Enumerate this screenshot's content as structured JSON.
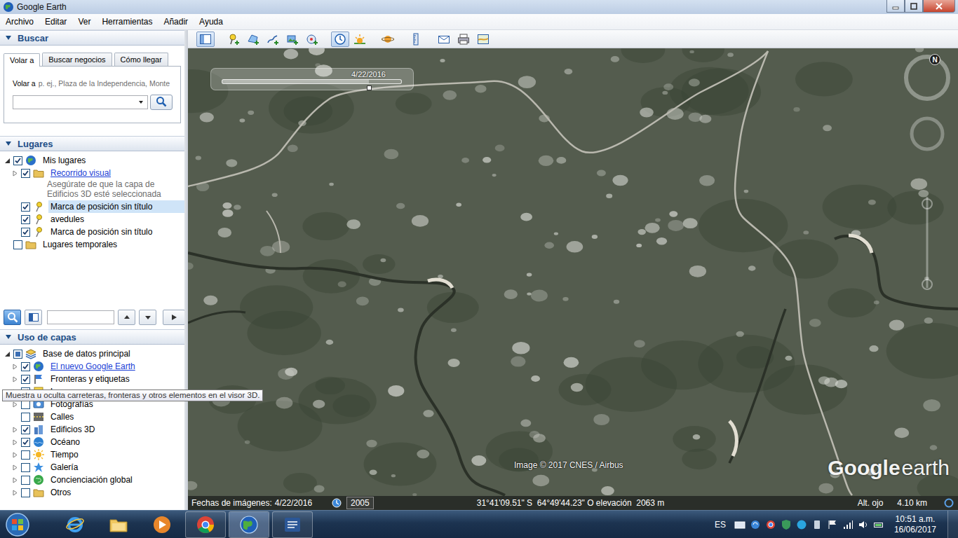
{
  "window": {
    "title": "Google Earth"
  },
  "menu": [
    "Archivo",
    "Editar",
    "Ver",
    "Herramientas",
    "Añadir",
    "Ayuda"
  ],
  "search": {
    "header": "Buscar",
    "expanded": true,
    "tabs": [
      {
        "label": "Volar a",
        "selected": true
      },
      {
        "label": "Buscar negocios",
        "selected": false
      },
      {
        "label": "Cómo llegar",
        "selected": false
      }
    ],
    "prompt": "Volar a",
    "hint": "p. ej., Plaza de la Independencia, Monte"
  },
  "places": {
    "header": "Lugares",
    "expanded": true,
    "items": [
      {
        "label": "Mis lugares",
        "depth": 0,
        "kind": "globe",
        "has_children": true,
        "expanded": true,
        "checked": true,
        "partial": false,
        "selected": false,
        "link": false
      },
      {
        "label": "Recorrido visual",
        "depth": 1,
        "kind": "folder",
        "has_children": true,
        "expanded": false,
        "checked": true,
        "partial": false,
        "selected": false,
        "link": true,
        "note": "Asegúrate de que la capa de Edificios 3D esté seleccionada"
      },
      {
        "label": "Marca de posición sin título",
        "depth": 1,
        "kind": "placemark",
        "has_children": false,
        "expanded": false,
        "checked": true,
        "partial": false,
        "selected": true,
        "link": false
      },
      {
        "label": "avedules",
        "depth": 1,
        "kind": "placemark",
        "has_children": false,
        "expanded": false,
        "checked": true,
        "partial": false,
        "selected": false,
        "link": false
      },
      {
        "label": "Marca de posición sin título",
        "depth": 1,
        "kind": "placemark",
        "has_children": false,
        "expanded": false,
        "checked": true,
        "partial": false,
        "selected": false,
        "link": false
      },
      {
        "label": "Lugares temporales",
        "depth": 0,
        "kind": "folder",
        "has_children": false,
        "expanded": false,
        "checked": false,
        "partial": false,
        "selected": false,
        "link": false
      }
    ]
  },
  "panel_tools": [
    {
      "kind": "search",
      "selected": true
    },
    {
      "kind": "panel",
      "selected": false
    }
  ],
  "layers": {
    "header": "Uso de capas",
    "expanded": true,
    "items": [
      {
        "label": "Base de datos principal",
        "depth": 0,
        "kind": "database",
        "has_children": true,
        "expanded": true,
        "checked": true,
        "partial": true,
        "selected": false,
        "link": false
      },
      {
        "label": "El nuevo Google Earth",
        "depth": 1,
        "kind": "globe",
        "has_children": true,
        "expanded": false,
        "checked": true,
        "partial": false,
        "selected": false,
        "link": true
      },
      {
        "label": "Fronteras y etiquetas",
        "depth": 1,
        "kind": "flag",
        "has_children": true,
        "expanded": false,
        "checked": true,
        "partial": false,
        "selected": false,
        "link": false
      },
      {
        "label": "Lugares",
        "depth": 1,
        "kind": "places",
        "has_children": true,
        "expanded": false,
        "checked": true,
        "partial": false,
        "selected": false,
        "link": false
      },
      {
        "label": "Fotografías",
        "depth": 1,
        "kind": "photos",
        "has_children": true,
        "expanded": false,
        "checked": false,
        "partial": false,
        "selected": false,
        "link": false
      },
      {
        "label": "Calles",
        "depth": 1,
        "kind": "roads",
        "has_children": false,
        "expanded": false,
        "checked": false,
        "partial": false,
        "selected": false,
        "link": false
      },
      {
        "label": "Edificios 3D",
        "depth": 1,
        "kind": "buildings",
        "has_children": true,
        "expanded": false,
        "checked": true,
        "partial": false,
        "selected": false,
        "link": false
      },
      {
        "label": "Océano",
        "depth": 1,
        "kind": "ocean",
        "has_children": true,
        "expanded": false,
        "checked": true,
        "partial": false,
        "selected": false,
        "link": false
      },
      {
        "label": "Tiempo",
        "depth": 1,
        "kind": "weather",
        "has_children": true,
        "expanded": false,
        "checked": false,
        "partial": false,
        "selected": false,
        "link": false
      },
      {
        "label": "Galería",
        "depth": 1,
        "kind": "gallery",
        "has_children": true,
        "expanded": false,
        "checked": false,
        "partial": false,
        "selected": false,
        "link": false
      },
      {
        "label": "Concienciación global",
        "depth": 1,
        "kind": "awareness",
        "has_children": true,
        "expanded": false,
        "checked": false,
        "partial": false,
        "selected": false,
        "link": false
      },
      {
        "label": "Otros",
        "depth": 1,
        "kind": "other",
        "has_children": true,
        "expanded": false,
        "checked": false,
        "partial": false,
        "selected": false,
        "link": false
      }
    ]
  },
  "tooltip": "Muestra u oculta carreteras, fronteras y otros elementos en el visor 3D.",
  "toolbar": [
    {
      "kind": "sidebar",
      "group": 1,
      "selected": true
    },
    {
      "kind": "placemark",
      "group": 2,
      "selected": false
    },
    {
      "kind": "polygon",
      "group": 2,
      "selected": false
    },
    {
      "kind": "path",
      "group": 2,
      "selected": false
    },
    {
      "kind": "overlay",
      "group": 2,
      "selected": false
    },
    {
      "kind": "tour",
      "group": 2,
      "selected": false
    },
    {
      "kind": "history",
      "group": 3,
      "selected": true
    },
    {
      "kind": "sun",
      "group": 3,
      "selected": false
    },
    {
      "kind": "planet",
      "group": 4,
      "selected": false
    },
    {
      "kind": "ruler",
      "group": 5,
      "selected": false
    },
    {
      "kind": "email",
      "group": 6,
      "selected": false
    },
    {
      "kind": "print",
      "group": 6,
      "selected": false
    },
    {
      "kind": "maps",
      "group": 6,
      "selected": false
    }
  ],
  "time_slider": {
    "date": "4/22/2016",
    "level": 0.82
  },
  "map": {
    "attribution": "Image © 2017 CNES / Airbus",
    "logo_brand": "Google",
    "logo_product": "earth",
    "compass": "N"
  },
  "status_bar": {
    "imagery_label": "Fechas de imágenes:",
    "imagery_date": "4/22/2016",
    "historical_year": "2005",
    "coordinates": "31°41'09.51\" S  64°49'44.23\" O elevación  2063 m",
    "eye_alt_label": "Alt. ojo",
    "eye_alt": "4.10 km"
  },
  "taskbar": {
    "apps": [
      {
        "kind": "ie",
        "open": false,
        "selected": false
      },
      {
        "kind": "explorer",
        "open": false,
        "selected": false
      },
      {
        "kind": "media",
        "open": false,
        "selected": false
      },
      {
        "kind": "chrome",
        "open": true,
        "selected": false
      },
      {
        "kind": "earth",
        "open": true,
        "selected": true
      },
      {
        "kind": "word",
        "open": true,
        "selected": false
      }
    ],
    "language": "ES",
    "time": "10:51 a.m.",
    "date": "16/06/2017"
  }
}
